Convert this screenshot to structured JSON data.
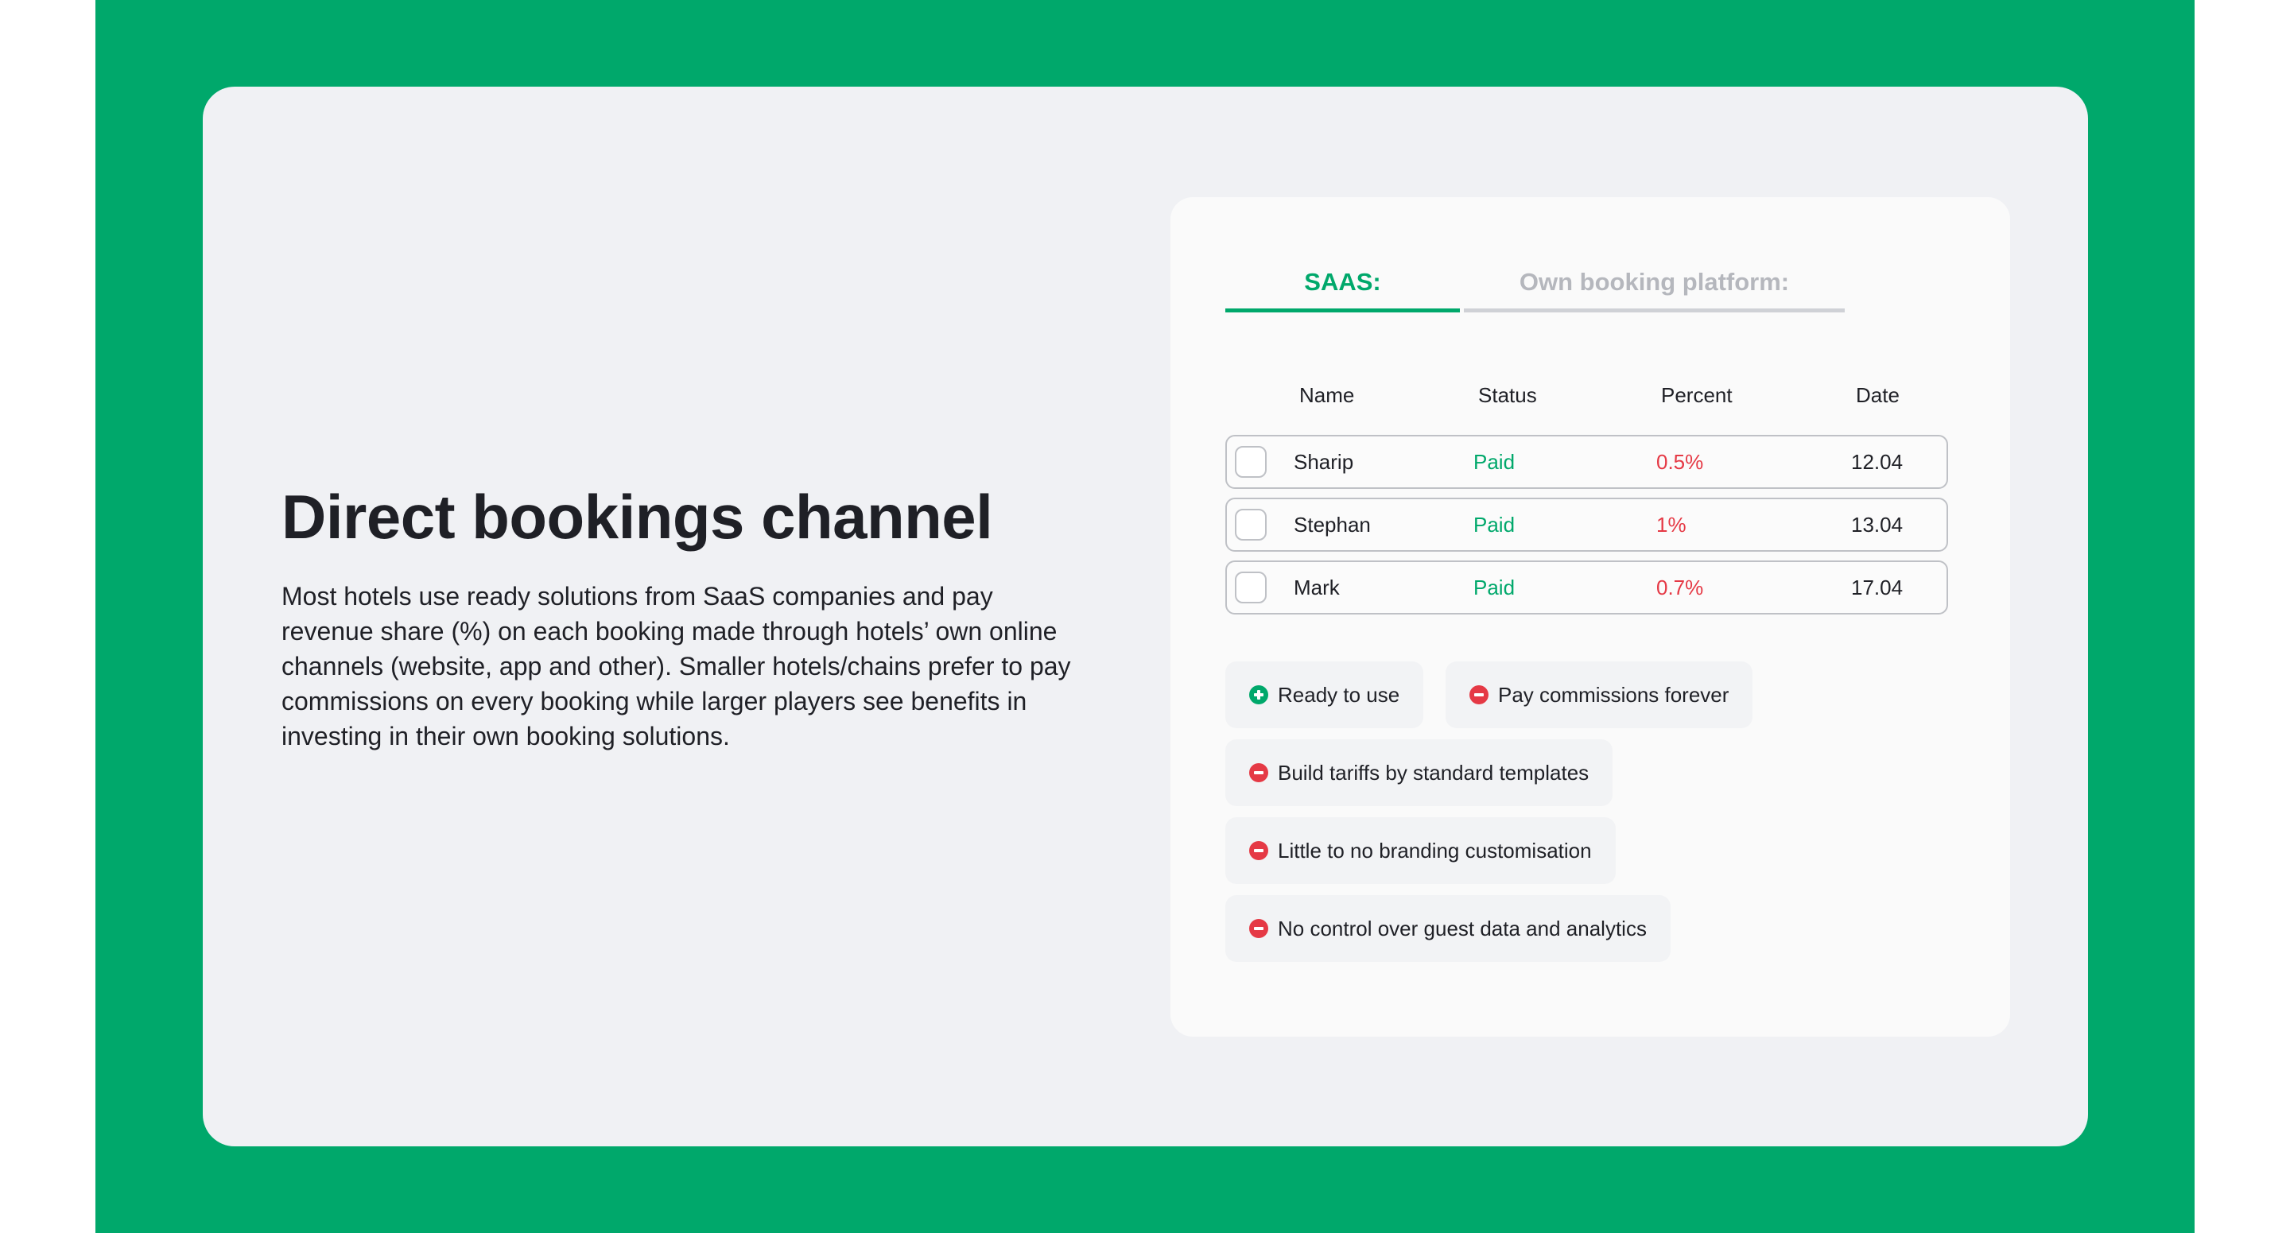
{
  "hero": {
    "title": "Direct bookings channel",
    "description": "Most hotels use ready solutions from SaaS companies and pay revenue share (%) on each booking made through hotels’ own online channels (website, app and other). Smaller hotels/chains prefer to pay commissions on every booking while larger players see benefits in investing in their own booking solutions."
  },
  "tabs": [
    {
      "label": "SAAS:",
      "active": true
    },
    {
      "label": "Own booking platform:",
      "active": false
    }
  ],
  "table": {
    "columns": [
      "Name",
      "Status",
      "Percent",
      "Date"
    ],
    "rows": [
      {
        "name": "Sharip",
        "status": "Paid",
        "percent": "0.5%",
        "date": "12.04"
      },
      {
        "name": "Stephan",
        "status": "Paid",
        "percent": "1%",
        "date": "13.04"
      },
      {
        "name": "Mark",
        "status": "Paid",
        "percent": "0.7%",
        "date": "17.04"
      }
    ]
  },
  "features": [
    {
      "label": "Ready to use",
      "icon": "plus-circle-icon",
      "kind": "pro"
    },
    {
      "label": "Pay commissions forever",
      "icon": "minus-circle-icon",
      "kind": "con"
    },
    {
      "label": "Build tariffs by standard templates",
      "icon": "minus-circle-icon",
      "kind": "con"
    },
    {
      "label": "Little to no branding customisation",
      "icon": "minus-circle-icon",
      "kind": "con"
    },
    {
      "label": "No control over guest data and analytics",
      "icon": "minus-circle-icon",
      "kind": "con"
    }
  ],
  "colors": {
    "brand_green": "#00a86b",
    "negative_red": "#e53945",
    "card_bg": "#f0f1f4",
    "text_dark": "#1f2026",
    "tab_inactive": "#b5b7bd"
  }
}
